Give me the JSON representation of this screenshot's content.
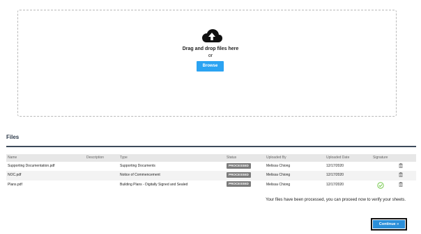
{
  "upload": {
    "drag_text": "Drag and drop files here",
    "or_text": "or",
    "browse_label": "Browse"
  },
  "files": {
    "title": "Files",
    "columns": {
      "name": "Name",
      "description": "Description",
      "type": "Type",
      "status": "Status",
      "uploaded_by": "Uploaded By",
      "uploaded_date": "Uploaded Date",
      "signature": "Signature"
    },
    "rows": [
      {
        "name": "Supporting Documentation.pdf",
        "description": "",
        "type": "Supporting Documents",
        "status": "PROCESSED",
        "uploaded_by": "Melissa Chiong",
        "uploaded_date": "12/17/2020",
        "signature_icon": ""
      },
      {
        "name": "NOC.pdf",
        "description": "",
        "type": "Notice of Commencement",
        "status": "PROCESSED",
        "uploaded_by": "Melissa Chiong",
        "uploaded_date": "12/17/2020",
        "signature_icon": ""
      },
      {
        "name": "Plans.pdf",
        "description": "",
        "type": "Building Plans - Digitally Signed and Sealed",
        "status": "PROCESSED",
        "uploaded_by": "Melissa Chiong",
        "uploaded_date": "12/17/2020",
        "signature_icon": "check-circle-icon"
      }
    ]
  },
  "message": "Your files have been processed, you can proceed now to verify your sheets.",
  "continue_label": "Continue »",
  "colors": {
    "browse": "#2ba3f2",
    "continue": "#2b8fd9",
    "badge": "#7b7b7b",
    "signature_check": "#5bbf2a"
  },
  "icons": {
    "upload": "cloud-upload-icon",
    "delete": "trash-icon"
  }
}
